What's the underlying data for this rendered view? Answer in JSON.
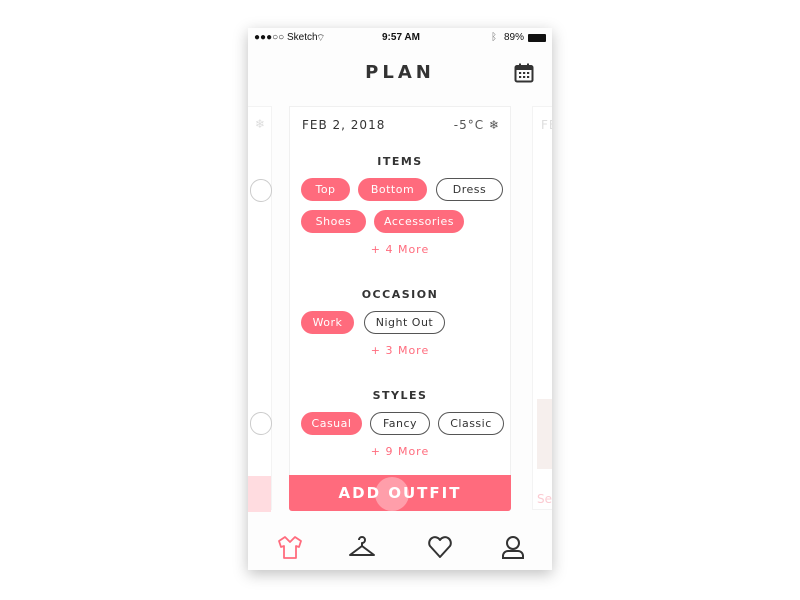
{
  "status": {
    "carrier": "●●●○○ Sketch",
    "time": "9:57 AM",
    "battery": "89%"
  },
  "header": {
    "title": "PLAN",
    "calendar_icon": "calendar-icon"
  },
  "card": {
    "date": "FEB 2, 2018",
    "temperature": "-5°C",
    "weather_icon": "snowflake-icon",
    "items": {
      "title": "ITEMS",
      "chips": [
        {
          "label": "Top",
          "selected": true
        },
        {
          "label": "Bottom",
          "selected": true
        },
        {
          "label": "Dress",
          "selected": false
        },
        {
          "label": "Shoes",
          "selected": true
        },
        {
          "label": "Accessories",
          "selected": true
        }
      ],
      "more": "+ 4 More"
    },
    "occasion": {
      "title": "OCCASION",
      "chips": [
        {
          "label": "Work",
          "selected": true
        },
        {
          "label": "Night Out",
          "selected": false
        }
      ],
      "more": "+ 3 More"
    },
    "styles": {
      "title": "STYLES",
      "chips": [
        {
          "label": "Casual",
          "selected": true
        },
        {
          "label": "Fancy",
          "selected": false
        },
        {
          "label": "Classic",
          "selected": false
        }
      ],
      "more": "+ 9 More"
    },
    "add_button": "ADD OUTFIT"
  },
  "next_card": {
    "date_partial": "FE",
    "label_partial": "Se"
  },
  "nav": [
    "shirt-icon",
    "hanger-icon",
    "heart-icon",
    "profile-icon"
  ],
  "colors": {
    "accent": "#ff6b7d",
    "text": "#333333"
  }
}
